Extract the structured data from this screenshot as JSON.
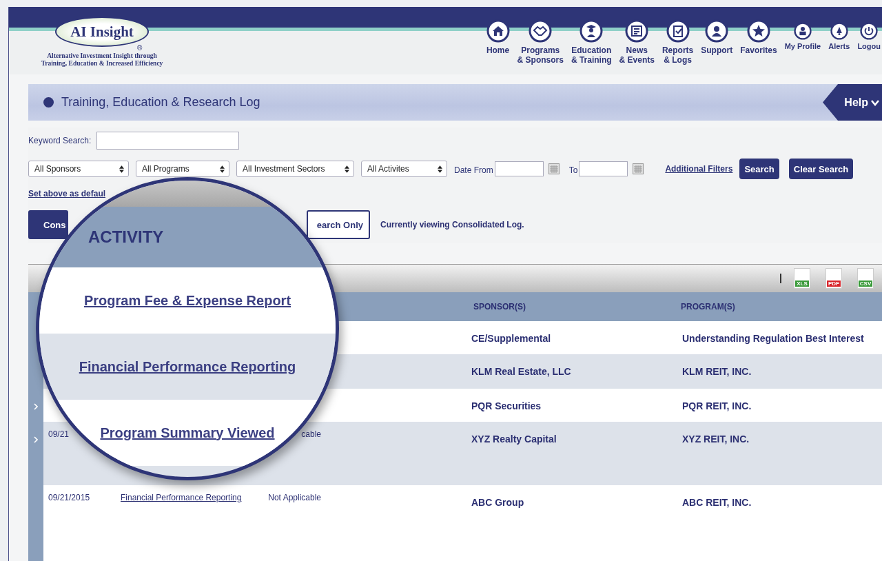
{
  "logo": {
    "brand": "AI Insight",
    "mark": "®",
    "tagline": [
      "Alternative Investment Insight through",
      "Training, Education & Increased Efficiency"
    ]
  },
  "nav": [
    {
      "label": "Home"
    },
    {
      "label": "Programs\n& Sponsors"
    },
    {
      "label": "Education\n& Training"
    },
    {
      "label": "News\n& Events"
    },
    {
      "label": "Reports\n& Logs"
    },
    {
      "label": "Support"
    },
    {
      "label": "Favorites"
    }
  ],
  "user_nav": [
    {
      "label": "My Profile"
    },
    {
      "label": "Alerts"
    },
    {
      "label": "Logou"
    }
  ],
  "page_title": "Training, Education & Research Log",
  "help": "Help",
  "filters": {
    "keyword_label": "Keyword Search:",
    "dropdowns": [
      "All Sponsors",
      "All Programs",
      "All Investment Sectors",
      "All Activites"
    ],
    "date_from_label": "Date From",
    "date_to_label": "To",
    "additional_filters": "Additional Filters",
    "search": "Search",
    "clear_search": "Clear Search",
    "set_default": "Set above as defaul"
  },
  "view_buttons": [
    {
      "label": "Cons",
      "selected": true
    },
    {
      "label": "earch Only",
      "selected": false
    }
  ],
  "view_status": "Currently viewing Consolidated Log.",
  "exports": [
    "XLS",
    "PDF",
    "CSV"
  ],
  "table": {
    "columns": [
      "SPONSOR(S)",
      "PROGRAM(S)"
    ],
    "rows": [
      {
        "expander": false,
        "sponsor": "CE/Supplemental",
        "program": "Understanding Regulation Best Interest"
      },
      {
        "expander": false,
        "sponsor": "KLM Real Estate, LLC",
        "program": "KLM REIT, INC."
      },
      {
        "expander": true,
        "sponsor": "PQR Securities",
        "program": "PQR REIT, INC."
      },
      {
        "expander": true,
        "date": "09/21",
        "column_3": "cable",
        "sponsor": "XYZ Realty Capital",
        "program": "XYZ REIT, INC."
      },
      {
        "expander": false,
        "date": "09/21/2015",
        "activity": "Financial Performance Reporting",
        "column_3": "Not Applicable",
        "sponsor": "ABC Group",
        "program": "ABC REIT, INC."
      }
    ]
  },
  "magnifier": {
    "heading": "ACTIVITY",
    "items": [
      "Program Fee & Expense Report",
      "Financial Performance Reporting",
      "Program Summary Viewed"
    ]
  }
}
